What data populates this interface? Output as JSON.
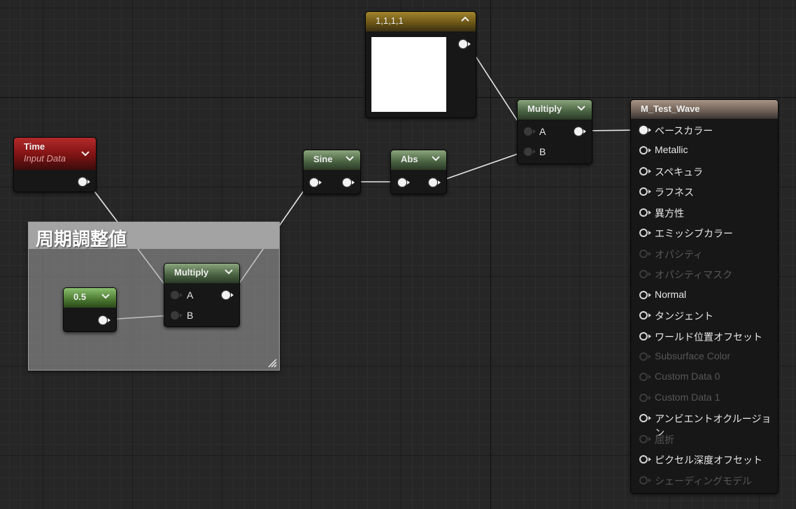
{
  "nodes": {
    "color_constant": {
      "title": "1,1,1,1"
    },
    "time": {
      "title": "Time",
      "subtitle": "Input Data"
    },
    "sine": {
      "title": "Sine"
    },
    "abs": {
      "title": "Abs"
    },
    "multiply_top": {
      "title": "Multiply",
      "pin_a": "A",
      "pin_b": "B"
    },
    "multiply_mid": {
      "title": "Multiply",
      "pin_a": "A",
      "pin_b": "B"
    },
    "constant_half": {
      "title": "0.5"
    }
  },
  "comment": {
    "title": "周期調整値"
  },
  "material": {
    "title": "M_Test_Wave",
    "pins": [
      {
        "label": "ベースカラー",
        "state": "connected"
      },
      {
        "label": "Metallic",
        "state": "active"
      },
      {
        "label": "スペキュラ",
        "state": "active"
      },
      {
        "label": "ラフネス",
        "state": "active"
      },
      {
        "label": "異方性",
        "state": "active"
      },
      {
        "label": "エミッシブカラー",
        "state": "active"
      },
      {
        "label": "オパシティ",
        "state": "disabled"
      },
      {
        "label": "オパシティマスク",
        "state": "disabled"
      },
      {
        "label": "Normal",
        "state": "active"
      },
      {
        "label": "タンジェント",
        "state": "active"
      },
      {
        "label": "ワールド位置オフセット",
        "state": "active"
      },
      {
        "label": "Subsurface Color",
        "state": "disabled"
      },
      {
        "label": "Custom Data 0",
        "state": "disabled"
      },
      {
        "label": "Custom Data 1",
        "state": "disabled"
      },
      {
        "label": "アンビエントオクルージョン",
        "state": "active"
      },
      {
        "label": "屈折",
        "state": "disabled"
      },
      {
        "label": "ピクセル深度オフセット",
        "state": "active"
      },
      {
        "label": "シェーディングモデル",
        "state": "disabled"
      }
    ]
  },
  "colors": {
    "grid_bg": "#262626",
    "wire": "#e6e6e6",
    "header_green": "#4c6544",
    "header_red": "#7d1212",
    "header_gold": "#6d5617",
    "header_result": "#6c5e54",
    "color_preview": "#ffffff"
  }
}
